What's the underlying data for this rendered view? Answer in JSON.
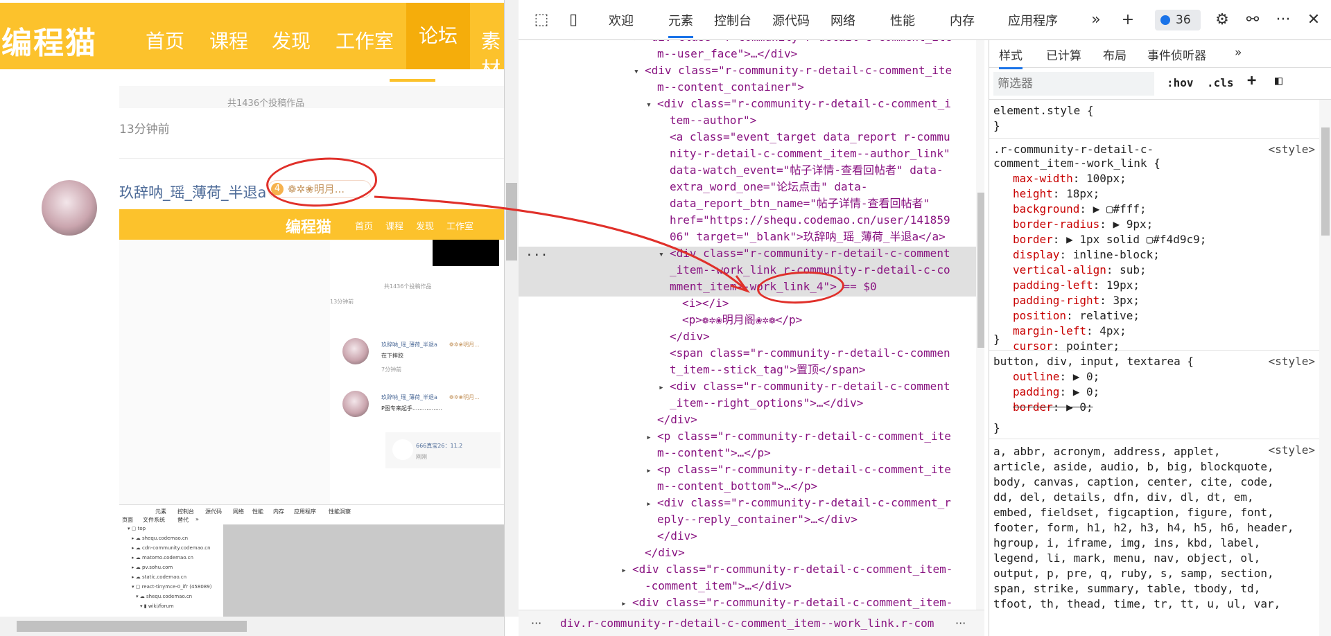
{
  "site": {
    "logo": "编程猫",
    "nav": [
      "首页",
      "课程",
      "发现",
      "工作室",
      "论坛",
      "素材"
    ],
    "work_count": "共1436个投稿作品",
    "time_ago": "13分钟前",
    "author": "玖辞呐_瑶_薄荷_半退a",
    "badge_level": "4",
    "badge_text": "❁✲❀明月...",
    "shot": {
      "logo": "编程猫",
      "nav": [
        "首页",
        "课程",
        "发现",
        "工作室"
      ],
      "work_count": "共1436个投稿作品",
      "time1": "13分钟前",
      "c1_author": "玖辞呐_瑶_薄荷_半退a",
      "c1_badge": "❁✲❀明月...",
      "c1_content": "在下摔跤",
      "c1_time": "7分钟前",
      "c2_author": "玖辞呐_瑶_薄荷_半退a",
      "c2_badge": "❁✲❀明月...",
      "c2_content": "P图专来起手.................",
      "reply_author": "666真宝26：11.2",
      "reply_time": "刚刚",
      "devtools_tabs": [
        "元素",
        "控制台",
        "源代码",
        "网络",
        "性能",
        "内存",
        "应用程序",
        "性能洞察"
      ],
      "devtools_subtabs": [
        "页面",
        "文件系统",
        "替代",
        "»"
      ],
      "tree": [
        "▾ ▢ top",
        "▸ ☁ shequ.codemao.cn",
        "▸ ☁ cdn-community.codemao.cn",
        "▸ ☁ matomo.codemao.cn",
        "▸ ☁ pv.sohu.com",
        "▸ ☁ static.codemao.cn",
        "▾ ▢ react-tinymce-0_ifr (458089)",
        "▾ ☁ shequ.codemao.cn",
        "▾ ▮ wiki/forum"
      ]
    }
  },
  "devtools": {
    "tabs": [
      "欢迎",
      "元素",
      "控制台",
      "源代码",
      "网络",
      "性能",
      "内存",
      "应用程序"
    ],
    "active_tab": "元素",
    "issues_count": "36",
    "more": "»",
    "add": "+",
    "menu": "···",
    "close": "✕",
    "elements": [
      {
        "indent": 1,
        "arrow": "▸",
        "html": "<div class=\"r-community-r-detail-c-comment_ite"
      },
      {
        "indent": 2,
        "arrow": "",
        "html": "m--user_face\">…</div>"
      },
      {
        "indent": 1,
        "arrow": "▾",
        "html": "<div class=\"r-community-r-detail-c-comment_ite"
      },
      {
        "indent": 2,
        "arrow": "",
        "html": "m--content_container\">"
      },
      {
        "indent": 2,
        "arrow": "▾",
        "html": "<div class=\"r-community-r-detail-c-comment_i"
      },
      {
        "indent": 3,
        "arrow": "",
        "html": "tem--author\">"
      },
      {
        "indent": 3,
        "arrow": "",
        "html": "<a class=\"event_target data_report r-commu"
      },
      {
        "indent": 3,
        "arrow": "",
        "html": "nity-r-detail-c-comment_item--author_link\""
      },
      {
        "indent": 3,
        "arrow": "",
        "html": "data-watch_event=\"帖子详情-查看回帖者\" data-"
      },
      {
        "indent": 3,
        "arrow": "",
        "html": "extra_word_one=\"论坛点击\" data-"
      },
      {
        "indent": 3,
        "arrow": "",
        "html": "data_report_btn_name=\"帖子详情-查看回帖者\""
      },
      {
        "indent": 3,
        "arrow": "",
        "html": "href=\"https://shequ.codemao.cn/user/141859"
      },
      {
        "indent": 3,
        "arrow": "",
        "html": "06\" target=\"_blank\">玖辞呐_瑶_薄荷_半退a</a>"
      },
      {
        "indent": 3,
        "arrow": "▾",
        "html": "<div class=\"r-community-r-detail-c-comment"
      },
      {
        "indent": 3,
        "arrow": "",
        "html": "_item--work_link r-community-r-detail-c-co"
      },
      {
        "indent": 3,
        "arrow": "",
        "html": "mment_item--work_link_4\"> == $0"
      },
      {
        "indent": 4,
        "arrow": "",
        "html": "<i></i>"
      },
      {
        "indent": 4,
        "arrow": "",
        "html": "<p>❁✲❀明月阁❀✲❁</p>"
      },
      {
        "indent": 3,
        "arrow": "",
        "html": "</div>"
      },
      {
        "indent": 3,
        "arrow": "",
        "html": "<span class=\"r-community-r-detail-c-commen"
      },
      {
        "indent": 3,
        "arrow": "",
        "html": "t_item--stick_tag\">置顶</span>"
      },
      {
        "indent": 3,
        "arrow": "▸",
        "html": "<div class=\"r-community-r-detail-c-comment"
      },
      {
        "indent": 3,
        "arrow": "",
        "html": "_item--right_options\">…</div>"
      },
      {
        "indent": 2,
        "arrow": "",
        "html": "</div>"
      },
      {
        "indent": 2,
        "arrow": "▸",
        "html": "<p class=\"r-community-r-detail-c-comment_ite"
      },
      {
        "indent": 2,
        "arrow": "",
        "html": "m--content\">…</p>"
      },
      {
        "indent": 2,
        "arrow": "▸",
        "html": "<p class=\"r-community-r-detail-c-comment_ite"
      },
      {
        "indent": 2,
        "arrow": "",
        "html": "m--content_bottom\">…</p>"
      },
      {
        "indent": 2,
        "arrow": "▸",
        "html": "<div class=\"r-community-r-detail-c-comment_r"
      },
      {
        "indent": 2,
        "arrow": "",
        "html": "eply--reply_container\">…</div>"
      },
      {
        "indent": 2,
        "arrow": "",
        "html": "</div>"
      },
      {
        "indent": 1,
        "arrow": "",
        "html": "</div>"
      },
      {
        "indent": 0,
        "arrow": "▸",
        "html": "<div class=\"r-community-r-detail-c-comment_item-"
      },
      {
        "indent": 1,
        "arrow": "",
        "html": "-comment_item\">…</div>"
      },
      {
        "indent": 0,
        "arrow": "▸",
        "html": "<div class=\"r-community-r-detail-c-comment_item-"
      }
    ],
    "breadcrumb": "div.r-community-r-detail-c-comment_item--work_link.r-community-r-detail-c-comment_item--work_link_4",
    "styles": {
      "tabs": [
        "样式",
        "已计算",
        "布局",
        "事件侦听器",
        "»"
      ],
      "filter_placeholder": "筛选器",
      "hov": ":hov",
      "cls": ".cls",
      "element_style": "element.style {",
      "close_brace": "}",
      "rule1_sel1": ".r-community-r-detail-c-",
      "rule1_sel2": "comment_item--work_link {",
      "origin": "<style>",
      "rule1_props": [
        {
          "name": "max-width",
          "value": "100px;"
        },
        {
          "name": "height",
          "value": "18px;"
        },
        {
          "name": "background",
          "value": "▶ ▢#fff;"
        },
        {
          "name": "border-radius",
          "value": "▶ 9px;"
        },
        {
          "name": "border",
          "value": "▶ 1px solid ▢#f4d9c9;"
        },
        {
          "name": "display",
          "value": "inline-block;"
        },
        {
          "name": "vertical-align",
          "value": "sub;"
        },
        {
          "name": "padding-left",
          "value": "19px;"
        },
        {
          "name": "padding-right",
          "value": "3px;"
        },
        {
          "name": "position",
          "value": "relative;"
        },
        {
          "name": "margin-left",
          "value": "4px;"
        },
        {
          "name": "cursor",
          "value": "pointer;"
        }
      ],
      "rule2_sel": "button, div, input, textarea {",
      "rule2_props": [
        {
          "name": "outline",
          "value": "▶ 0;"
        },
        {
          "name": "padding",
          "value": "▶ 0;"
        },
        {
          "name": "border",
          "value": "▶ 0;"
        }
      ],
      "rule3_lines": [
        "a, abbr, acronym, address, applet,",
        "article, aside, audio, b, big, blockquote,",
        "body, canvas, caption, center, cite, code,",
        "dd, del, details, dfn, div, dl, dt, em,",
        "embed, fieldset, figcaption, figure, font,",
        "footer, form, h1, h2, h3, h4, h5, h6, header,",
        "hgroup, i, iframe, img, ins, kbd, label,",
        "legend, li, mark, menu, nav, object, ol,",
        "output, p, pre, q, ruby, s, samp, section,",
        "span, strike, summary, table, tbody, td,",
        "tfoot, th, thead, time, tr, tt, u, ul, var,"
      ]
    }
  }
}
